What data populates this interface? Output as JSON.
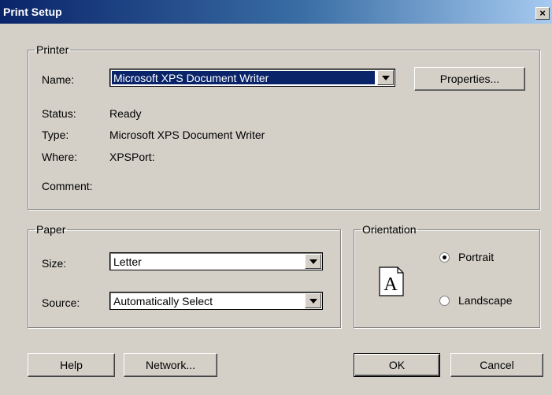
{
  "window": {
    "title": "Print Setup",
    "close_label": "×"
  },
  "printer": {
    "legend": "Printer",
    "name_label": "Name:",
    "name_value": "Microsoft XPS Document Writer",
    "properties_label": "Properties...",
    "status_label": "Status:",
    "status_value": "Ready",
    "type_label": "Type:",
    "type_value": "Microsoft XPS Document Writer",
    "where_label": "Where:",
    "where_value": "XPSPort:",
    "comment_label": "Comment:",
    "comment_value": ""
  },
  "paper": {
    "legend": "Paper",
    "size_label": "Size:",
    "size_value": "Letter",
    "source_label": "Source:",
    "source_value": "Automatically Select"
  },
  "orientation": {
    "legend": "Orientation",
    "portrait_label": "Portrait",
    "landscape_label": "Landscape",
    "selected": "Portrait",
    "page_glyph": "A"
  },
  "buttons": {
    "help": "Help",
    "network": "Network...",
    "ok": "OK",
    "cancel": "Cancel"
  }
}
